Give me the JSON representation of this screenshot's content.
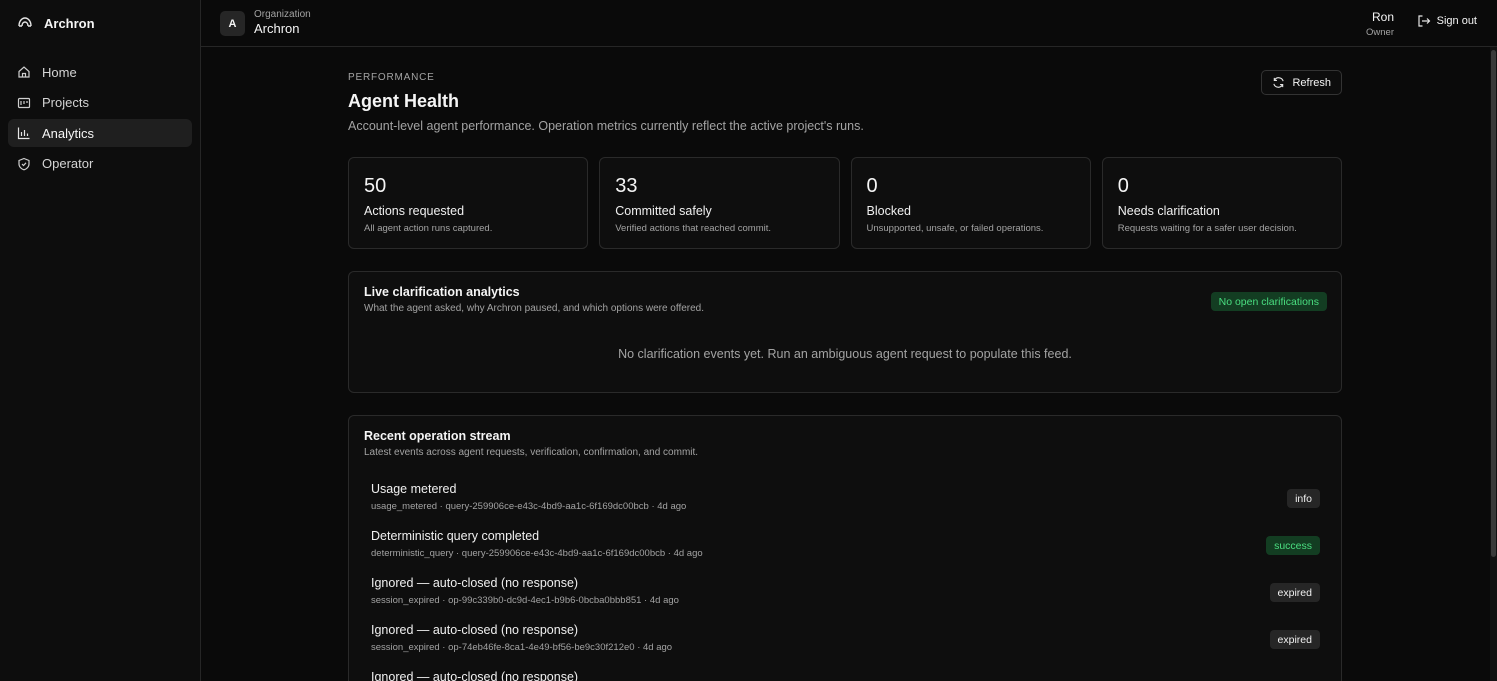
{
  "app": {
    "brand": "Archron"
  },
  "sidebar": {
    "items": [
      {
        "label": "Home",
        "icon": "home-icon"
      },
      {
        "label": "Projects",
        "icon": "projects-icon"
      },
      {
        "label": "Analytics",
        "icon": "chart-icon",
        "active": true
      },
      {
        "label": "Operator",
        "icon": "shield-icon"
      }
    ]
  },
  "topbar": {
    "org_initial": "A",
    "org_label": "Organization",
    "org_name": "Archron",
    "user_name": "Ron",
    "user_role": "Owner",
    "signout_label": "Sign out"
  },
  "page": {
    "eyebrow": "PERFORMANCE",
    "title": "Agent Health",
    "subtitle": "Account-level agent performance. Operation metrics currently reflect the active project's runs.",
    "refresh_label": "Refresh"
  },
  "stats": [
    {
      "value": "50",
      "label": "Actions requested",
      "desc": "All agent action runs captured."
    },
    {
      "value": "33",
      "label": "Committed safely",
      "desc": "Verified actions that reached commit."
    },
    {
      "value": "0",
      "label": "Blocked",
      "desc": "Unsupported, unsafe, or failed operations."
    },
    {
      "value": "0",
      "label": "Needs clarification",
      "desc": "Requests waiting for a safer user decision."
    }
  ],
  "clarification": {
    "title": "Live clarification analytics",
    "subtitle": "What the agent asked, why Archron paused, and which options were offered.",
    "badge": "No open clarifications",
    "empty": "No clarification events yet. Run an ambiguous agent request to populate this feed."
  },
  "operations": {
    "title": "Recent operation stream",
    "subtitle": "Latest events across agent requests, verification, confirmation, and commit.",
    "items": [
      {
        "title": "Usage metered",
        "meta": "usage_metered · query-259906ce-e43c-4bd9-aa1c-6f169dc00bcb · 4d ago",
        "badge": "info"
      },
      {
        "title": "Deterministic query completed",
        "meta": "deterministic_query · query-259906ce-e43c-4bd9-aa1c-6f169dc00bcb · 4d ago",
        "badge": "success"
      },
      {
        "title": "Ignored — auto-closed (no response)",
        "meta": "session_expired · op-99c339b0-dc9d-4ec1-b9b6-0bcba0bbb851 · 4d ago",
        "badge": "expired"
      },
      {
        "title": "Ignored — auto-closed (no response)",
        "meta": "session_expired · op-74eb46fe-8ca1-4e49-bf56-be9c30f212e0 · 4d ago",
        "badge": "expired"
      },
      {
        "title": "Ignored — auto-closed (no response)",
        "meta": "",
        "badge": ""
      }
    ]
  },
  "colors": {
    "background": "#0a0a0a",
    "success_bg": "#133d22",
    "success_text": "#4ade80"
  }
}
